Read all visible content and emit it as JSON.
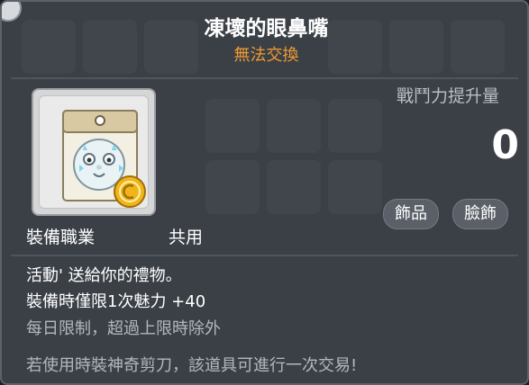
{
  "item": {
    "name": "凍壞的眼鼻嘴",
    "trade_status": "無法交換"
  },
  "stats": {
    "cp_label": "戰鬥力提升量",
    "cp_value": "0"
  },
  "tags": [
    "飾品",
    "臉飾"
  ],
  "equip": {
    "job_label": "裝備職業",
    "job_value": "共用"
  },
  "description": [
    "活動' 送給你的禮物。",
    "裝備時僅限1次魅力 +40",
    "每日限制，超過上限時除外",
    "若使用時裝神奇剪刀，該道具可進行一次交易!"
  ],
  "colors": {
    "title": "#ffffff",
    "trade_status": "#f29b32",
    "text_primary": "#ffffff",
    "text_secondary": "#b3b8be",
    "background": "#3b4047"
  }
}
